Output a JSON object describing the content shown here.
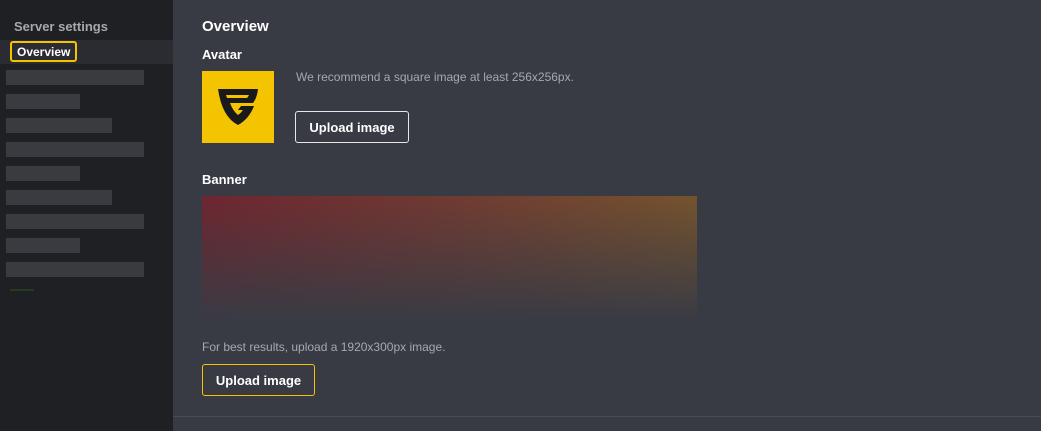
{
  "sidebar": {
    "heading": "Server settings",
    "active_item": "Overview",
    "placeholder_items": [
      {
        "name": "sidebar-item-placeholder-1"
      },
      {
        "name": "sidebar-item-placeholder-2"
      },
      {
        "name": "sidebar-item-placeholder-3"
      },
      {
        "name": "sidebar-item-placeholder-4"
      },
      {
        "name": "sidebar-item-placeholder-5"
      },
      {
        "name": "sidebar-item-placeholder-6"
      },
      {
        "name": "sidebar-item-placeholder-7"
      },
      {
        "name": "sidebar-item-placeholder-8"
      },
      {
        "name": "sidebar-item-placeholder-9"
      }
    ]
  },
  "main": {
    "title": "Overview",
    "avatar": {
      "label": "Avatar",
      "hint": "We recommend a square image at least 256x256px.",
      "upload_label": "Upload image",
      "logo_icon": "guilded-logo-icon"
    },
    "banner": {
      "label": "Banner",
      "hint": "For best results, upload a 1920x300px image.",
      "upload_label": "Upload image"
    }
  },
  "colors": {
    "accent": "#f5c400",
    "background": "#393b44",
    "sidebar": "#1f2024",
    "muted_text": "#a6a8b0"
  }
}
